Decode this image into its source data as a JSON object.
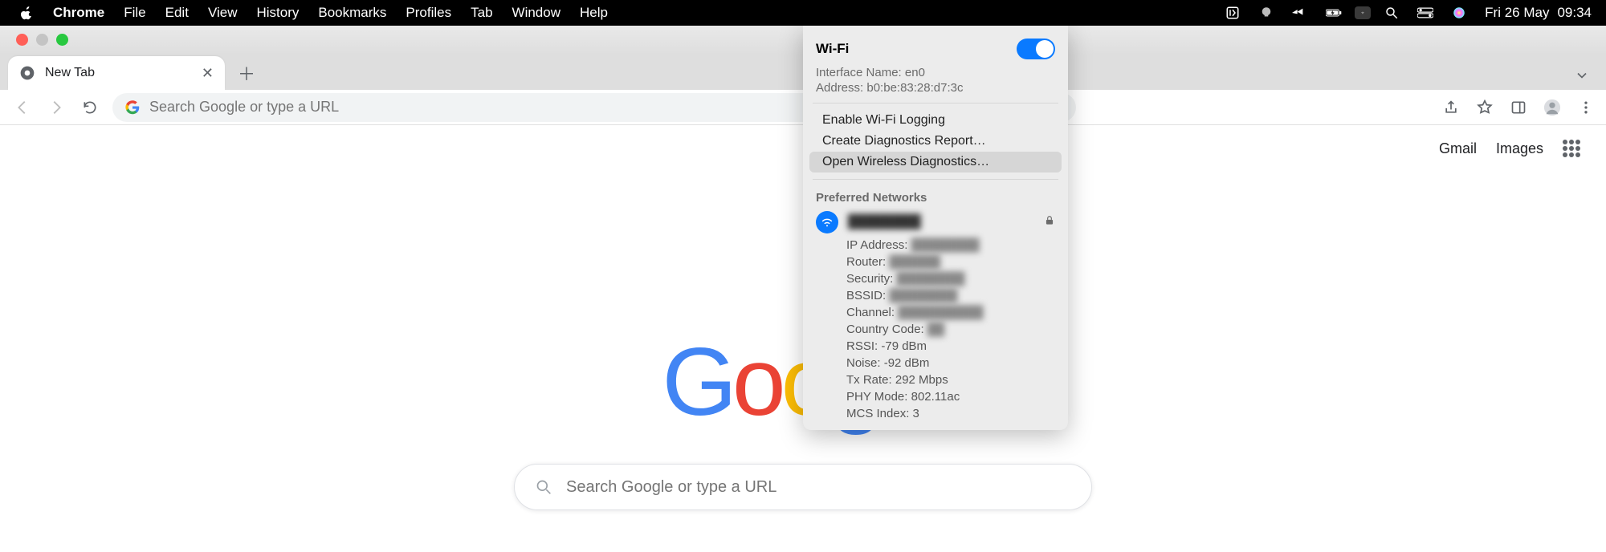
{
  "menubar": {
    "app": "Chrome",
    "items": [
      "File",
      "Edit",
      "View",
      "History",
      "Bookmarks",
      "Profiles",
      "Tab",
      "Window",
      "Help"
    ],
    "date": "Fri 26 May",
    "time": "09:34"
  },
  "tabs": {
    "active_title": "New Tab"
  },
  "toolbar": {
    "omnibox_placeholder": "Search Google or type a URL"
  },
  "content": {
    "links": {
      "gmail": "Gmail",
      "images": "Images"
    },
    "search_placeholder": "Search Google or type a URL"
  },
  "wifi": {
    "title": "Wi-Fi",
    "enabled": true,
    "interface_label": "Interface Name:",
    "interface_value": "en0",
    "address_label": "Address:",
    "address_value": "b0:be:83:28:d7:3c",
    "actions": {
      "enable_logging": "Enable Wi-Fi Logging",
      "create_report": "Create Diagnostics Report…",
      "open_diagnostics": "Open Wireless Diagnostics…"
    },
    "preferred_networks_title": "Preferred Networks",
    "network": {
      "ssid": "████████",
      "details": {
        "ip_label": "IP Address:",
        "ip_value": "████████",
        "router_label": "Router:",
        "router_value": "██████",
        "security_label": "Security:",
        "security_value": "████████",
        "bssid_label": "BSSID:",
        "bssid_value": "████████",
        "channel_label": "Channel:",
        "channel_value": "██████████",
        "country_label": "Country Code:",
        "country_value": "██",
        "rssi_label": "RSSI:",
        "rssi_value": "-79 dBm",
        "noise_label": "Noise:",
        "noise_value": "-92 dBm",
        "tx_label": "Tx Rate:",
        "tx_value": "292 Mbps",
        "phy_label": "PHY Mode:",
        "phy_value": "802.11ac",
        "mcs_label": "MCS Index:",
        "mcs_value": "3"
      }
    }
  }
}
